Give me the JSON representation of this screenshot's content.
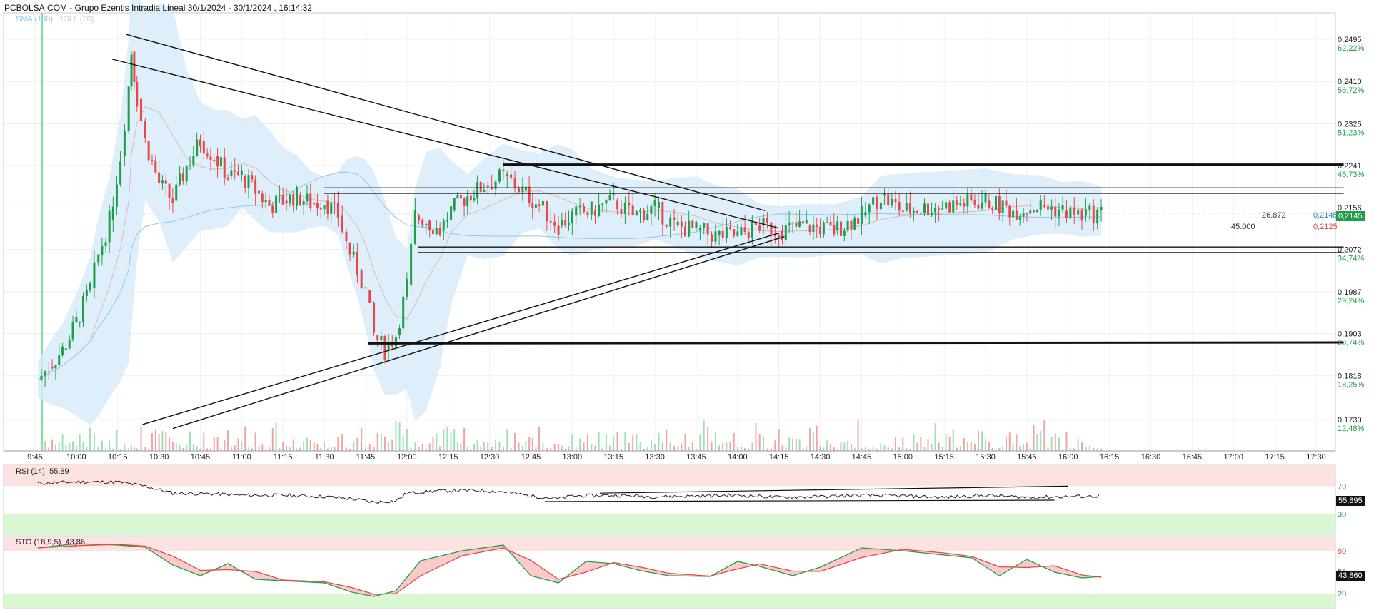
{
  "header": {
    "title": "PCBOLSA.COM - Grupo Ezentis Intradia Lineal 30/1/2024 - 30/1/2024 , 16:14:32",
    "sma_label": "SMA (100)",
    "boll_label": "BOLL (20)"
  },
  "colors": {
    "up": "#1f9e4a",
    "down": "#e8474a",
    "band_fill": "#d6ebfa",
    "sma_line": "#8cc8ee",
    "boll_mid": "#d7b9b9",
    "rsi_zone_high": "#fde2e2",
    "rsi_zone_low": "#d9f7d3",
    "last_price_tag": "#1f9e4a",
    "ask_tag": "#2d7bd6",
    "bid_color": "#e8474a"
  },
  "price_axis": {
    "ticks": [
      {
        "price": "0,2495",
        "pct": "62,22%"
      },
      {
        "price": "0,2410",
        "pct": "56,72%"
      },
      {
        "price": "0,2325",
        "pct": "51,23%"
      },
      {
        "price": "0,2241",
        "pct": "45,73%"
      },
      {
        "price": "0,2156",
        "pct": ""
      },
      {
        "price": "0,2072",
        "pct": "34,74%"
      },
      {
        "price": "0,1987",
        "pct": "29,24%"
      },
      {
        "price": "0,1903",
        "pct": "23,74%"
      },
      {
        "price": "0,1818",
        "pct": "18,25%"
      },
      {
        "price": "0,1730",
        "pct": "12,48%"
      }
    ],
    "last_price": "0,2145",
    "ask_price": "0,2145",
    "bid_price": "0,2125",
    "ask_volume": "26.872",
    "bid_volume": "45.000"
  },
  "time_axis": [
    "9:45",
    "10:00",
    "10:15",
    "10:30",
    "10:45",
    "11:00",
    "11:15",
    "11:30",
    "11:45",
    "12:00",
    "12:15",
    "12:30",
    "12:45",
    "13:00",
    "13:15",
    "13:30",
    "13:45",
    "14:00",
    "14:15",
    "14:30",
    "14:45",
    "15:00",
    "15:15",
    "15:30",
    "15:45",
    "16:00",
    "16:15",
    "16:30",
    "16:45",
    "17:00",
    "17:15",
    "17:30"
  ],
  "rsi": {
    "label": "RSI (14)",
    "value_text": "55,89",
    "last_value": "55,895",
    "levels": [
      "70",
      "50",
      "30"
    ]
  },
  "sto": {
    "label": "STO (18,9,5)",
    "value_text": "43,86",
    "last_value": "43,860",
    "levels": [
      "80",
      "50",
      "20"
    ]
  },
  "chart_data": {
    "type": "candlestick",
    "title": "Grupo Ezentis Intradia Lineal 30/1/2024 - 30/1/2024 , 16:14:32",
    "x_range": [
      "9:45",
      "17:30"
    ],
    "ylim": [
      0.1706,
      0.2528
    ],
    "close_series": [
      [
        "9:46",
        0.181
      ],
      [
        "9:50",
        0.1835
      ],
      [
        "9:55",
        0.187
      ],
      [
        "10:00",
        0.1925
      ],
      [
        "10:05",
        0.1995
      ],
      [
        "10:08",
        0.206
      ],
      [
        "10:12",
        0.213
      ],
      [
        "10:16",
        0.226
      ],
      [
        "10:19",
        0.24
      ],
      [
        "10:20",
        0.247
      ],
      [
        "10:22",
        0.2375
      ],
      [
        "10:25",
        0.229
      ],
      [
        "10:30",
        0.2205
      ],
      [
        "10:35",
        0.217
      ],
      [
        "10:40",
        0.224
      ],
      [
        "10:45",
        0.229
      ],
      [
        "10:50",
        0.226
      ],
      [
        "10:55",
        0.222
      ],
      [
        "11:00",
        0.222
      ],
      [
        "11:05",
        0.219
      ],
      [
        "11:10",
        0.216
      ],
      [
        "11:15",
        0.217
      ],
      [
        "11:20",
        0.218
      ],
      [
        "11:25",
        0.2165
      ],
      [
        "11:30",
        0.217
      ],
      [
        "11:35",
        0.214
      ],
      [
        "11:38",
        0.2085
      ],
      [
        "11:42",
        0.203
      ],
      [
        "11:45",
        0.199
      ],
      [
        "11:48",
        0.19
      ],
      [
        "11:52",
        0.187
      ],
      [
        "11:56",
        0.19
      ],
      [
        "12:00",
        0.2
      ],
      [
        "12:03",
        0.214
      ],
      [
        "12:07",
        0.213
      ],
      [
        "12:12",
        0.211
      ],
      [
        "12:16",
        0.215
      ],
      [
        "12:22",
        0.218
      ],
      [
        "12:28",
        0.22
      ],
      [
        "12:35",
        0.222
      ],
      [
        "12:42",
        0.219
      ],
      [
        "12:48",
        0.216
      ],
      [
        "12:55",
        0.212
      ],
      [
        "13:00",
        0.214
      ],
      [
        "13:07",
        0.215
      ],
      [
        "13:15",
        0.217
      ],
      [
        "13:22",
        0.214
      ],
      [
        "13:30",
        0.2155
      ],
      [
        "13:37",
        0.212
      ],
      [
        "13:45",
        0.211
      ],
      [
        "13:52",
        0.21
      ],
      [
        "14:00",
        0.21
      ],
      [
        "14:08",
        0.212
      ],
      [
        "14:15",
        0.211
      ],
      [
        "14:25",
        0.212
      ],
      [
        "14:35",
        0.211
      ],
      [
        "14:45",
        0.214
      ],
      [
        "14:52",
        0.218
      ],
      [
        "15:00",
        0.215
      ],
      [
        "15:30",
        0.217
      ],
      [
        "15:40",
        0.215
      ],
      [
        "15:50",
        0.216
      ],
      [
        "15:58",
        0.215
      ],
      [
        "16:05",
        0.214
      ],
      [
        "16:12",
        0.2145
      ]
    ],
    "rsi_series": [
      [
        "9:46",
        74
      ],
      [
        "10:00",
        76
      ],
      [
        "10:15",
        76
      ],
      [
        "10:25",
        70
      ],
      [
        "10:35",
        60
      ],
      [
        "10:50",
        59
      ],
      [
        "11:00",
        57
      ],
      [
        "11:15",
        57
      ],
      [
        "11:30",
        55
      ],
      [
        "11:40",
        52
      ],
      [
        "11:48",
        47
      ],
      [
        "11:56",
        49
      ],
      [
        "12:00",
        60
      ],
      [
        "12:10",
        63
      ],
      [
        "12:25",
        64
      ],
      [
        "12:35",
        62
      ],
      [
        "12:45",
        56
      ],
      [
        "12:55",
        52
      ],
      [
        "13:00",
        56
      ],
      [
        "13:15",
        57
      ],
      [
        "13:30",
        55
      ],
      [
        "13:45",
        56
      ],
      [
        "14:00",
        57
      ],
      [
        "14:15",
        54
      ],
      [
        "14:30",
        55
      ],
      [
        "14:45",
        57
      ],
      [
        "15:00",
        56
      ],
      [
        "15:15",
        54
      ],
      [
        "15:30",
        57
      ],
      [
        "15:45",
        54
      ],
      [
        "16:00",
        55
      ],
      [
        "16:12",
        55.9
      ]
    ],
    "sto_k_series": [
      [
        "9:46",
        84
      ],
      [
        "10:00",
        90
      ],
      [
        "10:15",
        88
      ],
      [
        "10:25",
        85
      ],
      [
        "10:35",
        60
      ],
      [
        "10:45",
        45
      ],
      [
        "10:55",
        62
      ],
      [
        "11:05",
        40
      ],
      [
        "11:15",
        38
      ],
      [
        "11:30",
        35
      ],
      [
        "11:40",
        22
      ],
      [
        "11:48",
        16
      ],
      [
        "11:56",
        24
      ],
      [
        "12:05",
        66
      ],
      [
        "12:20",
        80
      ],
      [
        "12:35",
        88
      ],
      [
        "12:45",
        45
      ],
      [
        "12:55",
        35
      ],
      [
        "13:05",
        65
      ],
      [
        "13:15",
        62
      ],
      [
        "13:25",
        52
      ],
      [
        "13:35",
        45
      ],
      [
        "13:50",
        44
      ],
      [
        "14:00",
        65
      ],
      [
        "14:08",
        58
      ],
      [
        "14:20",
        45
      ],
      [
        "14:30",
        57
      ],
      [
        "14:45",
        84
      ],
      [
        "15:00",
        80
      ],
      [
        "15:15",
        74
      ],
      [
        "15:25",
        70
      ],
      [
        "15:35",
        45
      ],
      [
        "15:45",
        68
      ],
      [
        "15:55",
        50
      ],
      [
        "16:05",
        42
      ],
      [
        "16:12",
        43.9
      ]
    ]
  }
}
